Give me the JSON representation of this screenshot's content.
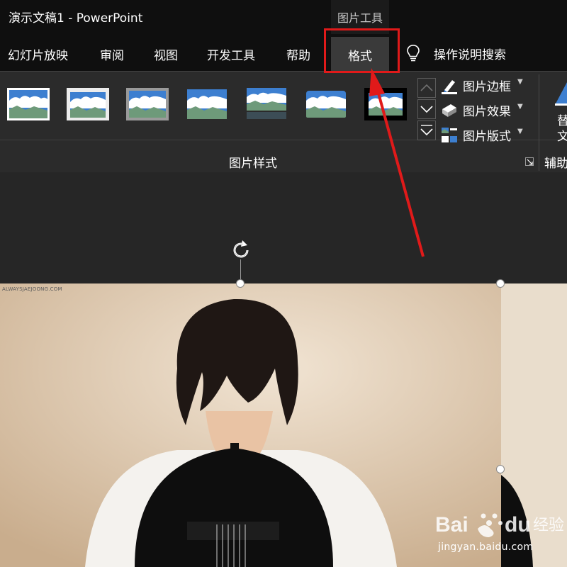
{
  "window": {
    "title": "演示文稿1 - PowerPoint",
    "context_group": "图片工具"
  },
  "tabs": [
    {
      "label": "幻灯片放映"
    },
    {
      "label": "审阅"
    },
    {
      "label": "视图"
    },
    {
      "label": "开发工具"
    },
    {
      "label": "帮助"
    }
  ],
  "active_tab": {
    "label": "格式"
  },
  "tell_me": {
    "label": "操作说明搜索",
    "icon": "lightbulb-icon"
  },
  "ribbon": {
    "picture_styles_group": "图片样式",
    "commands": [
      {
        "label": "图片边框",
        "icon": "picture-border-icon"
      },
      {
        "label": "图片效果",
        "icon": "picture-effects-icon"
      },
      {
        "label": "图片版式",
        "icon": "picture-layout-icon"
      }
    ],
    "alt_text_label": "替文",
    "accessibility_group": "辅助"
  },
  "photo": {
    "caption": "ALWAYSJAEJOONG.COM"
  },
  "watermark": {
    "brand": "Baidu经验",
    "url": "jingyan.baidu.com"
  },
  "colors": {
    "highlight": "#e01a1a",
    "ribbon_bg": "#2b2b2b",
    "titlebar_bg": "#0f0f0f"
  }
}
